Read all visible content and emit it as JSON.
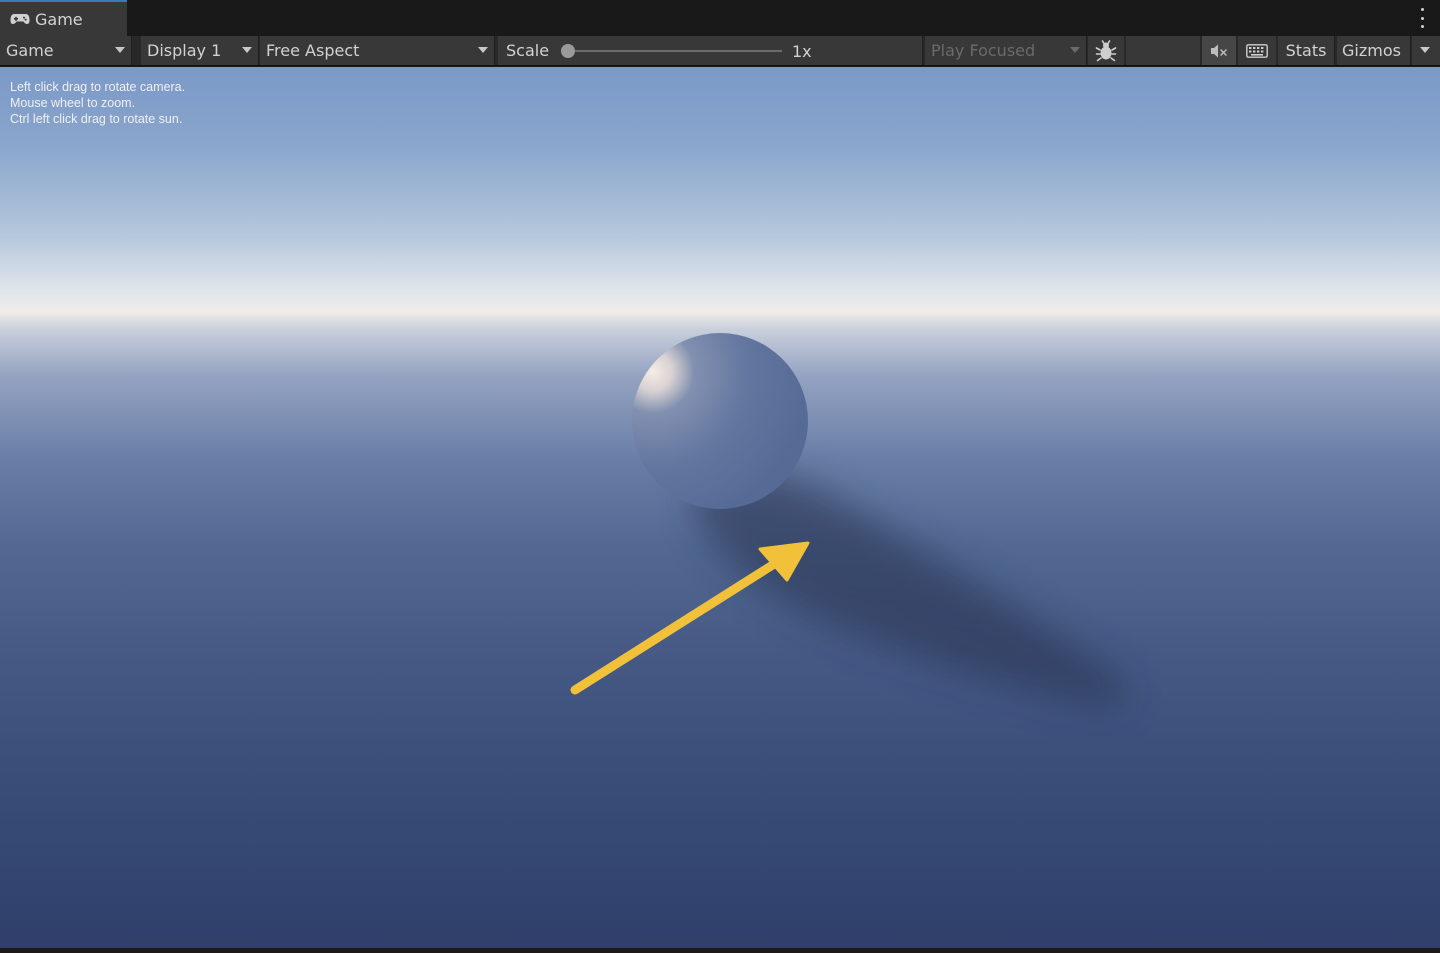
{
  "window": {
    "tab_label": "Game"
  },
  "toolbar": {
    "view_dropdown": "Game",
    "display_dropdown": "Display 1",
    "aspect_dropdown": "Free Aspect",
    "scale_label": "Scale",
    "scale_value": "1x",
    "scale_slider_fraction": 0.0,
    "play_mode_dropdown": "Play Focused",
    "stats_label": "Stats",
    "gizmos_label": "Gizmos",
    "icons": {
      "tab": "gamepad-icon",
      "debug": "bug-icon",
      "mute": "speaker-muted-icon",
      "keyboard": "keyboard-icon",
      "menu": "kebab-menu-icon"
    }
  },
  "viewport": {
    "help_lines": [
      "Left click drag to rotate camera.",
      "Mouse wheel to zoom.",
      "Ctrl left click drag to rotate sun."
    ],
    "annotation_color": "#f2c13a"
  }
}
